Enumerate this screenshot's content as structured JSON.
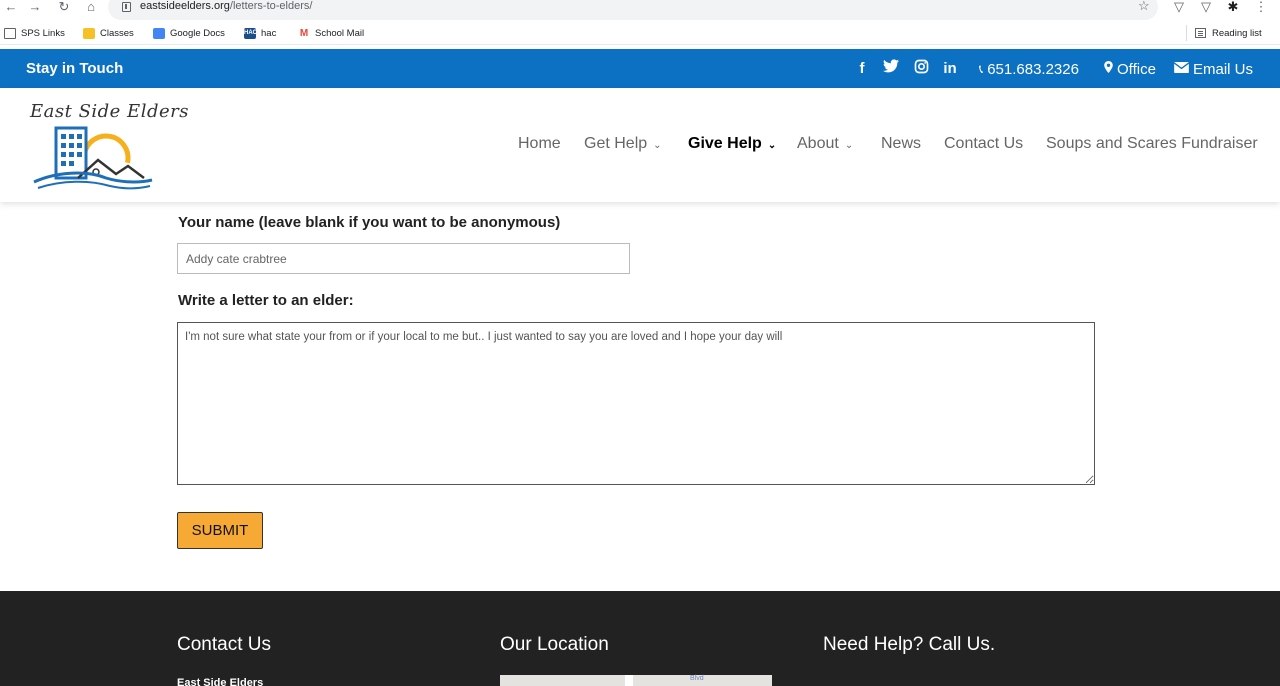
{
  "browser": {
    "url_host": "eastsideelders.org",
    "url_path": "/letters-to-elders/",
    "bookmarks": [
      {
        "label": "SPS Links",
        "icon": "folder-icon"
      },
      {
        "label": "Classes",
        "icon": "classroom-icon"
      },
      {
        "label": "Google Docs",
        "icon": "docs-icon"
      },
      {
        "label": "hac",
        "icon": "hac-icon",
        "badge": "HAC"
      },
      {
        "label": "School Mail",
        "icon": "gmail-icon",
        "badge": "M"
      }
    ],
    "reading_list": "Reading list"
  },
  "topbar": {
    "title": "Stay in Touch",
    "phone": "651.683.2326",
    "office": "Office",
    "email": "Email Us",
    "color": "#0c71c3",
    "social": [
      {
        "name": "facebook-icon",
        "glyph": "f"
      },
      {
        "name": "twitter-icon",
        "glyph": "🐦"
      },
      {
        "name": "instagram-icon",
        "glyph": "◎"
      },
      {
        "name": "linkedin-icon",
        "glyph": "in"
      }
    ]
  },
  "header": {
    "logo_text": "East Side Elders",
    "menu": [
      {
        "label": "Home"
      },
      {
        "label": "Get Help"
      },
      {
        "label": "Give Help"
      },
      {
        "label": "About"
      },
      {
        "label": "News"
      },
      {
        "label": "Contact Us"
      },
      {
        "label": "Soups and Scares Fundraiser"
      }
    ]
  },
  "form": {
    "name_label": "Your name (leave blank if you want to be anonymous)",
    "name_value": "Addy cate crabtree",
    "letter_label": "Write a letter to an elder:",
    "letter_value": "I'm not sure what state your from or if your local to me but.. I just wanted to say you are loved and I hope your day will",
    "submit_label": "SUBMIT",
    "submit_color": "#f7a935"
  },
  "footer": {
    "col1_title": "Contact Us",
    "col1_sub": "East Side Elders",
    "col2_title": "Our Location",
    "col3_title": "Need Help?  Call Us.",
    "map_label": "Blvd"
  }
}
